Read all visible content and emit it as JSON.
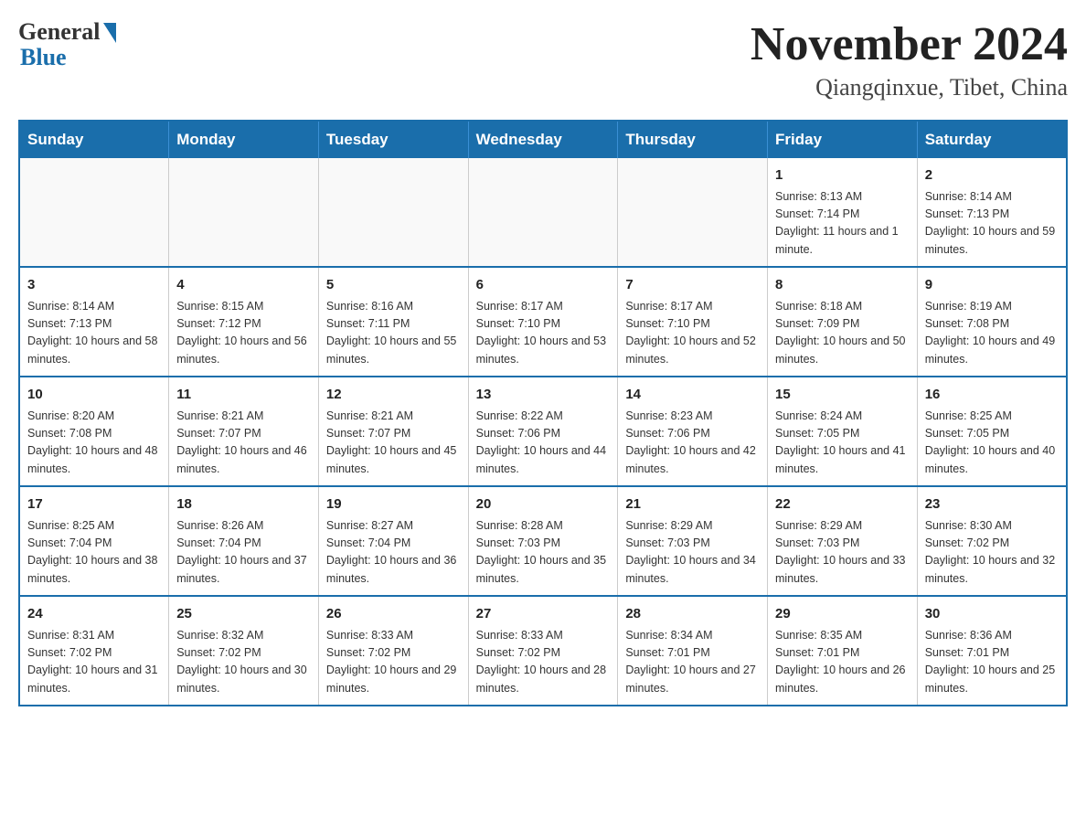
{
  "logo": {
    "general": "General",
    "blue": "Blue"
  },
  "header": {
    "month": "November 2024",
    "location": "Qiangqinxue, Tibet, China"
  },
  "weekdays": [
    "Sunday",
    "Monday",
    "Tuesday",
    "Wednesday",
    "Thursday",
    "Friday",
    "Saturday"
  ],
  "weeks": [
    [
      {
        "day": "",
        "info": ""
      },
      {
        "day": "",
        "info": ""
      },
      {
        "day": "",
        "info": ""
      },
      {
        "day": "",
        "info": ""
      },
      {
        "day": "",
        "info": ""
      },
      {
        "day": "1",
        "info": "Sunrise: 8:13 AM\nSunset: 7:14 PM\nDaylight: 11 hours and 1 minute."
      },
      {
        "day": "2",
        "info": "Sunrise: 8:14 AM\nSunset: 7:13 PM\nDaylight: 10 hours and 59 minutes."
      }
    ],
    [
      {
        "day": "3",
        "info": "Sunrise: 8:14 AM\nSunset: 7:13 PM\nDaylight: 10 hours and 58 minutes."
      },
      {
        "day": "4",
        "info": "Sunrise: 8:15 AM\nSunset: 7:12 PM\nDaylight: 10 hours and 56 minutes."
      },
      {
        "day": "5",
        "info": "Sunrise: 8:16 AM\nSunset: 7:11 PM\nDaylight: 10 hours and 55 minutes."
      },
      {
        "day": "6",
        "info": "Sunrise: 8:17 AM\nSunset: 7:10 PM\nDaylight: 10 hours and 53 minutes."
      },
      {
        "day": "7",
        "info": "Sunrise: 8:17 AM\nSunset: 7:10 PM\nDaylight: 10 hours and 52 minutes."
      },
      {
        "day": "8",
        "info": "Sunrise: 8:18 AM\nSunset: 7:09 PM\nDaylight: 10 hours and 50 minutes."
      },
      {
        "day": "9",
        "info": "Sunrise: 8:19 AM\nSunset: 7:08 PM\nDaylight: 10 hours and 49 minutes."
      }
    ],
    [
      {
        "day": "10",
        "info": "Sunrise: 8:20 AM\nSunset: 7:08 PM\nDaylight: 10 hours and 48 minutes."
      },
      {
        "day": "11",
        "info": "Sunrise: 8:21 AM\nSunset: 7:07 PM\nDaylight: 10 hours and 46 minutes."
      },
      {
        "day": "12",
        "info": "Sunrise: 8:21 AM\nSunset: 7:07 PM\nDaylight: 10 hours and 45 minutes."
      },
      {
        "day": "13",
        "info": "Sunrise: 8:22 AM\nSunset: 7:06 PM\nDaylight: 10 hours and 44 minutes."
      },
      {
        "day": "14",
        "info": "Sunrise: 8:23 AM\nSunset: 7:06 PM\nDaylight: 10 hours and 42 minutes."
      },
      {
        "day": "15",
        "info": "Sunrise: 8:24 AM\nSunset: 7:05 PM\nDaylight: 10 hours and 41 minutes."
      },
      {
        "day": "16",
        "info": "Sunrise: 8:25 AM\nSunset: 7:05 PM\nDaylight: 10 hours and 40 minutes."
      }
    ],
    [
      {
        "day": "17",
        "info": "Sunrise: 8:25 AM\nSunset: 7:04 PM\nDaylight: 10 hours and 38 minutes."
      },
      {
        "day": "18",
        "info": "Sunrise: 8:26 AM\nSunset: 7:04 PM\nDaylight: 10 hours and 37 minutes."
      },
      {
        "day": "19",
        "info": "Sunrise: 8:27 AM\nSunset: 7:04 PM\nDaylight: 10 hours and 36 minutes."
      },
      {
        "day": "20",
        "info": "Sunrise: 8:28 AM\nSunset: 7:03 PM\nDaylight: 10 hours and 35 minutes."
      },
      {
        "day": "21",
        "info": "Sunrise: 8:29 AM\nSunset: 7:03 PM\nDaylight: 10 hours and 34 minutes."
      },
      {
        "day": "22",
        "info": "Sunrise: 8:29 AM\nSunset: 7:03 PM\nDaylight: 10 hours and 33 minutes."
      },
      {
        "day": "23",
        "info": "Sunrise: 8:30 AM\nSunset: 7:02 PM\nDaylight: 10 hours and 32 minutes."
      }
    ],
    [
      {
        "day": "24",
        "info": "Sunrise: 8:31 AM\nSunset: 7:02 PM\nDaylight: 10 hours and 31 minutes."
      },
      {
        "day": "25",
        "info": "Sunrise: 8:32 AM\nSunset: 7:02 PM\nDaylight: 10 hours and 30 minutes."
      },
      {
        "day": "26",
        "info": "Sunrise: 8:33 AM\nSunset: 7:02 PM\nDaylight: 10 hours and 29 minutes."
      },
      {
        "day": "27",
        "info": "Sunrise: 8:33 AM\nSunset: 7:02 PM\nDaylight: 10 hours and 28 minutes."
      },
      {
        "day": "28",
        "info": "Sunrise: 8:34 AM\nSunset: 7:01 PM\nDaylight: 10 hours and 27 minutes."
      },
      {
        "day": "29",
        "info": "Sunrise: 8:35 AM\nSunset: 7:01 PM\nDaylight: 10 hours and 26 minutes."
      },
      {
        "day": "30",
        "info": "Sunrise: 8:36 AM\nSunset: 7:01 PM\nDaylight: 10 hours and 25 minutes."
      }
    ]
  ]
}
